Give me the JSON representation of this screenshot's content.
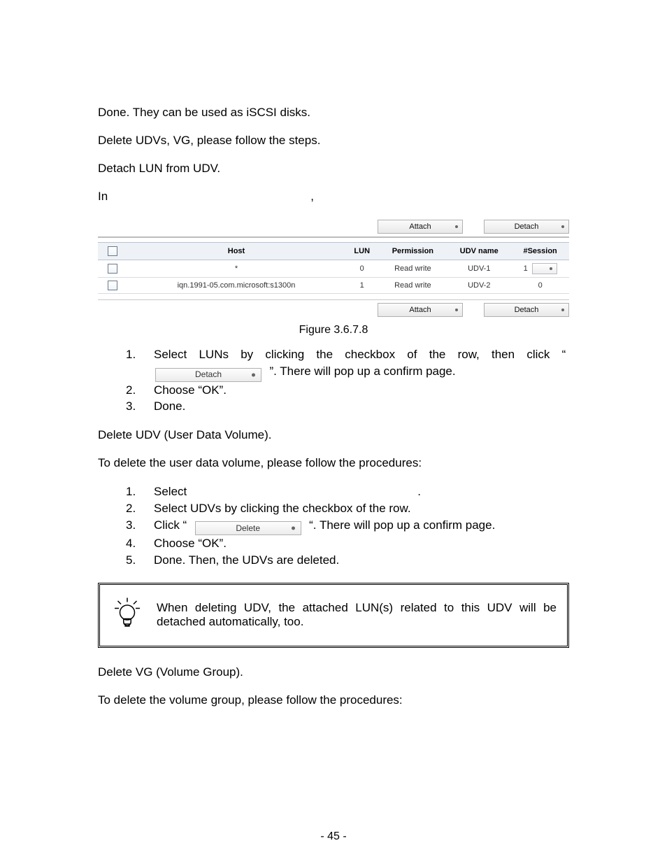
{
  "para_done_iscsi": "Done. They can be used as iSCSI disks.",
  "para_delete_intro": "Delete UDVs, VG, please follow the steps.",
  "para_detach_lun": "Detach LUN from UDV.",
  "inline_in": "In",
  "inline_comma": ",",
  "ui": {
    "attach_label": "Attach",
    "detach_label": "Detach",
    "delete_label": "Delete",
    "cols": {
      "host": "Host",
      "lun": "LUN",
      "perm": "Permission",
      "udv": "UDV name",
      "sess": "#Session"
    },
    "rows": [
      {
        "host": "*",
        "lun": "0",
        "perm": "Read write",
        "udv": "UDV-1",
        "sess": "1",
        "has_btn": true
      },
      {
        "host": "iqn.1991-05.com.microsoft:s1300n",
        "lun": "1",
        "perm": "Read write",
        "udv": "UDV-2",
        "sess": "0",
        "has_btn": false
      }
    ]
  },
  "fig_caption": "Figure 3.6.7.8",
  "list1": {
    "n1": "1.",
    "t1a": "Select LUNs by clicking the checkbox of the row, then click “ ",
    "t1b": " ”. There will pop up a confirm page.",
    "n2": "2.",
    "t2": "Choose “OK”.",
    "n3": "3.",
    "t3": "Done."
  },
  "para_delete_udv_head": "Delete UDV (User Data Volume).",
  "para_delete_udv_intro": "To delete the user data volume, please follow the procedures:",
  "list2": {
    "n1": "1.",
    "t1": "Select",
    "t1_trail": ".",
    "n2": "2.",
    "t2": "Select UDVs by clicking the checkbox of the row.",
    "n3": "3.",
    "t3a": "Click “ ",
    "t3b": " “. There will pop up a confirm page.",
    "n4": "4.",
    "t4": "Choose “OK”.",
    "n5": "5.",
    "t5": "Done. Then, the UDVs are deleted."
  },
  "note_text": "When deleting UDV, the attached LUN(s) related to this UDV will be detached automatically, too.",
  "para_delete_vg_head": "Delete VG (Volume Group).",
  "para_delete_vg_intro": "To delete the volume group, please follow the procedures:",
  "page_num": "- 45 -"
}
